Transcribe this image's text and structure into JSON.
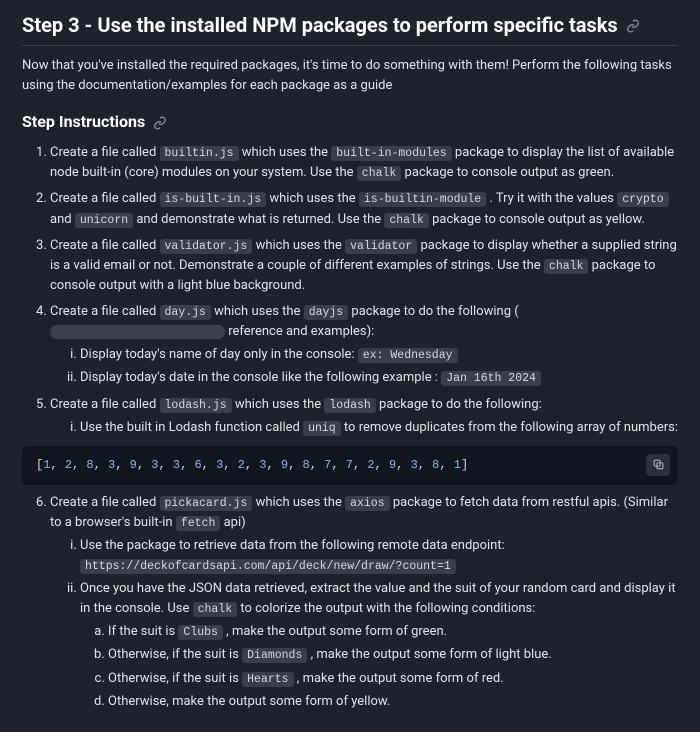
{
  "step_title": "Step 3 - Use the installed NPM packages to perform specific tasks",
  "intro": "Now that you've installed the required packages, it's time to do something with them! Perform the following tasks using the documentation/examples for each package as a guide",
  "subhead": "Step Instructions",
  "code": {
    "builtin_js": "builtin.js",
    "built_in_modules": "built-in-modules",
    "chalk": "chalk",
    "is_built_in_js": "is-built-in.js",
    "is_builtin_module": "is-builtin-module",
    "crypto": "crypto",
    "unicorn": "unicorn",
    "validator_js": "validator.js",
    "validator": "validator",
    "day_js": "day.js",
    "dayjs": "dayjs",
    "ex_wednesday": "ex: Wednesday",
    "jan_16th": "Jan 16th 2024",
    "lodash_js": "lodash.js",
    "lodash": "lodash",
    "uniq": "uniq",
    "pickacard_js": "pickacard.js",
    "axios": "axios",
    "fetch": "fetch",
    "endpoint": "https://deckofcardsapi.com/api/deck/new/draw/?count=1",
    "clubs": "Clubs",
    "diamonds": "Diamonds",
    "hearts": "Hearts"
  },
  "text": {
    "i1a": "Create a file called ",
    "i1b": " which uses the ",
    "i1c": " package to display the list of available node built-in (core) modules on your system. Use the ",
    "i1d": " package to console output as green.",
    "i2a": "Create a file called ",
    "i2b": " which uses the ",
    "i2c": " . Try it with the values ",
    "i2d": " and ",
    "i2e": " and demonstrate what is returned. Use the ",
    "i2f": " package to console output as yellow.",
    "i3a": "Create a file called ",
    "i3b": " which uses the ",
    "i3c": " package to display whether a supplied string is a valid email or not. Demonstrate a couple of different examples of strings. Use the ",
    "i3d": " package to console output with a light blue background.",
    "i4a": "Create a file called ",
    "i4b": " which uses the ",
    "i4c": " package to do the following (",
    "i4d": " reference and examples):",
    "i4_i": "Display today's name of day only in the console: ",
    "i4_ii_a": "Display today's date in the console like the following example : ",
    "i5a": "Create a file called ",
    "i5b": " which uses the ",
    "i5c": " package to do the following:",
    "i5_i_a": "Use the built in Lodash function called ",
    "i5_i_b": " to remove duplicates from the following array of numbers:",
    "i6a": "Create a file called ",
    "i6b": " which uses the ",
    "i6c": " package to fetch data from restful apis. (Similar to a browser's built-in ",
    "i6d": " api)",
    "i6_i": "Use the package to retrieve data from the following remote data endpoint: ",
    "i6_ii_a": "Once you have the JSON data retrieved, extract the value and the suit of your random card and display it in the console. Use ",
    "i6_ii_b": " to colorize the output with the following conditions:",
    "i6_ii_a1a": "If the suit is ",
    "i6_ii_a1b": " , make the output some form of green.",
    "i6_ii_b1a": "Otherwise, if the suit is ",
    "i6_ii_b1b": " , make the output some form of light blue.",
    "i6_ii_c1a": "Otherwise, if the suit is ",
    "i6_ii_c1b": " , make the output some form of red.",
    "i6_ii_d1": "Otherwise, make the output some form of yellow."
  },
  "array_numbers": [
    1,
    2,
    8,
    3,
    9,
    3,
    3,
    6,
    3,
    2,
    3,
    9,
    8,
    7,
    7,
    2,
    9,
    3,
    8,
    1
  ]
}
